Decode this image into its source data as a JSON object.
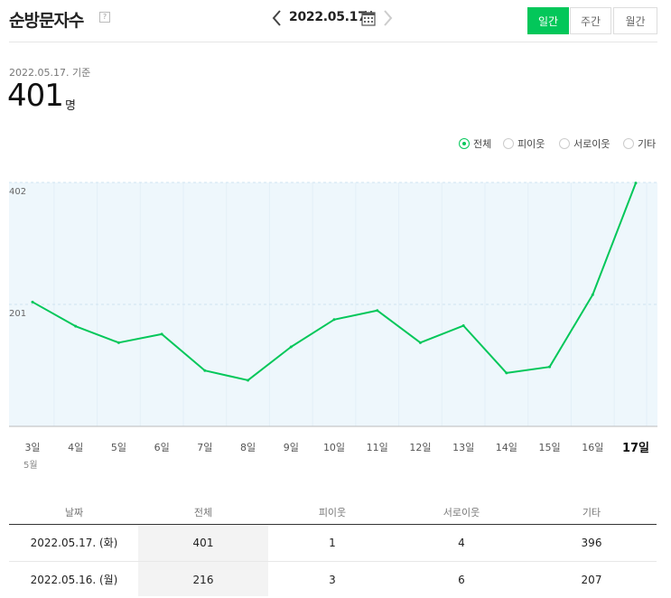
{
  "header": {
    "title": "순방문자수",
    "help_icon": "question-icon",
    "date": "2022.05.17.",
    "tabs": [
      {
        "label": "일간",
        "active": true
      },
      {
        "label": "주간",
        "active": false
      },
      {
        "label": "월간",
        "active": false
      }
    ]
  },
  "summary": {
    "basis": "2022.05.17. 기준",
    "value": "401",
    "unit": "명"
  },
  "legend": [
    {
      "label": "전체",
      "selected": true
    },
    {
      "label": "피이웃",
      "selected": false
    },
    {
      "label": "서로이웃",
      "selected": false
    },
    {
      "label": "기타",
      "selected": false
    }
  ],
  "chart_data": {
    "type": "area",
    "x": [
      "3일",
      "4일",
      "5일",
      "6일",
      "7일",
      "8일",
      "9일",
      "10일",
      "11일",
      "12일",
      "13일",
      "14일",
      "15일",
      "16일",
      "17일"
    ],
    "x_month_label": "5월",
    "values": [
      205,
      165,
      138,
      152,
      92,
      76,
      131,
      176,
      191,
      138,
      166,
      88,
      98,
      217,
      401
    ],
    "yticks": [
      201,
      402
    ],
    "ylim": [
      0,
      402
    ],
    "line_color": "#03c75a",
    "fill_color": "#eef7fc",
    "grid": true
  },
  "table": {
    "headers": [
      "날짜",
      "전체",
      "피이웃",
      "서로이웃",
      "기타"
    ],
    "rows": [
      [
        "2022.05.17. (화)",
        "401",
        "1",
        "4",
        "396"
      ],
      [
        "2022.05.16. (월)",
        "216",
        "3",
        "6",
        "207"
      ]
    ]
  }
}
